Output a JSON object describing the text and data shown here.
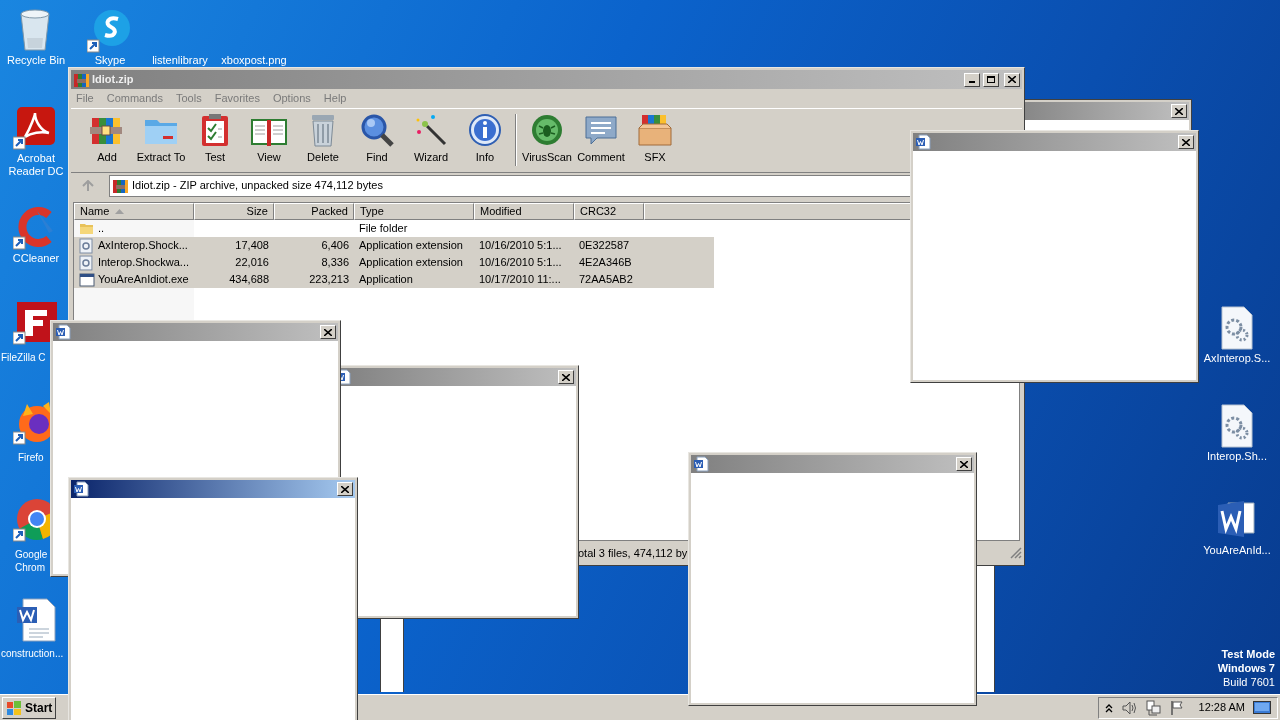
{
  "desktop_icons": [
    {
      "label": "Recycle Bin",
      "kind": "trash",
      "shortcut": false
    },
    {
      "label": "Skype",
      "kind": "chat",
      "shortcut": true
    },
    {
      "label": "listenlibrary",
      "kind": "blank"
    },
    {
      "label": "xboxpost.png",
      "kind": "blank"
    },
    {
      "label": "Acrobat Reader DC",
      "kind": "pdf",
      "shortcut": true
    },
    {
      "label": "CCleaner",
      "kind": "brush",
      "shortcut": true
    },
    {
      "label": "FileZilla C",
      "kind": "ftp",
      "shortcut": true
    },
    {
      "label": "Firefo",
      "kind": "fox",
      "shortcut": true
    },
    {
      "label": "Google Chrom",
      "kind": "browser",
      "shortcut": true
    },
    {
      "label": "construction...",
      "kind": "worddoc",
      "shortcut": false
    },
    {
      "label": "AxInterop.S...",
      "kind": "gearfile",
      "shortcut": false
    },
    {
      "label": "Interop.Sh...",
      "kind": "gearfile",
      "shortcut": false
    },
    {
      "label": "YouAreAnId...",
      "kind": "word",
      "shortcut": false
    }
  ],
  "archive_window": {
    "title": "Idiot.zip",
    "active": false,
    "menu": [
      "File",
      "Commands",
      "Tools",
      "Favorites",
      "Options",
      "Help"
    ],
    "toolbar": [
      {
        "label": "Add",
        "kind": "books"
      },
      {
        "label": "Extract To",
        "kind": "folder"
      },
      {
        "label": "Test",
        "kind": "clipboard"
      },
      {
        "label": "View",
        "kind": "book"
      },
      {
        "label": "Delete",
        "kind": "trash"
      },
      {
        "label": "Find",
        "kind": "magnifier"
      },
      {
        "label": "Wizard",
        "kind": "wand"
      },
      {
        "label": "Info",
        "kind": "info"
      },
      {
        "kind": "separator"
      },
      {
        "label": "VirusScan",
        "kind": "bug"
      },
      {
        "label": "Comment",
        "kind": "speech"
      },
      {
        "label": "SFX",
        "kind": "box"
      }
    ],
    "address": "Idiot.zip - ZIP archive, unpacked size 474,112 bytes",
    "columns": [
      {
        "label": "Name",
        "sorted": true
      },
      {
        "label": "Size",
        "sorted": false
      },
      {
        "label": "Packed",
        "sorted": false
      },
      {
        "label": "Type",
        "sorted": false
      },
      {
        "label": "Modified",
        "sorted": false
      },
      {
        "label": "CRC32",
        "sorted": false
      }
    ],
    "rows": [
      {
        "name": "..",
        "type": "File folder",
        "kind": "folder",
        "selected": false
      },
      {
        "name": "AxInterop.Shock...",
        "size": "17,408",
        "packed": "6,406",
        "type": "Application extension",
        "modified": "10/16/2010 5:1...",
        "crc": "0E322587",
        "kind": "component",
        "selected": true
      },
      {
        "name": "Interop.Shockwa...",
        "size": "22,016",
        "packed": "8,336",
        "type": "Application extension",
        "modified": "10/16/2010 5:1...",
        "crc": "4E2A346B",
        "kind": "component",
        "selected": true
      },
      {
        "name": "YouAreAnIdiot.exe",
        "size": "434,688",
        "packed": "223,213",
        "type": "Application",
        "modified": "10/17/2010 11:...",
        "crc": "72AA5AB2",
        "kind": "program",
        "selected": true
      }
    ],
    "status": "otal 3 files, 474,112 by"
  },
  "popups": [
    {
      "active": false
    },
    {
      "active": false
    },
    {
      "active": false
    },
    {
      "active": false
    },
    {
      "active": true
    }
  ],
  "os_notice": [
    {
      "text": "Test Mode",
      "bold": true
    },
    {
      "text": "Windows 7",
      "bold": true
    },
    {
      "text": "Build 7601",
      "bold": false
    }
  ],
  "taskbar": {
    "start": "Start",
    "clock": "12:28 AM"
  }
}
